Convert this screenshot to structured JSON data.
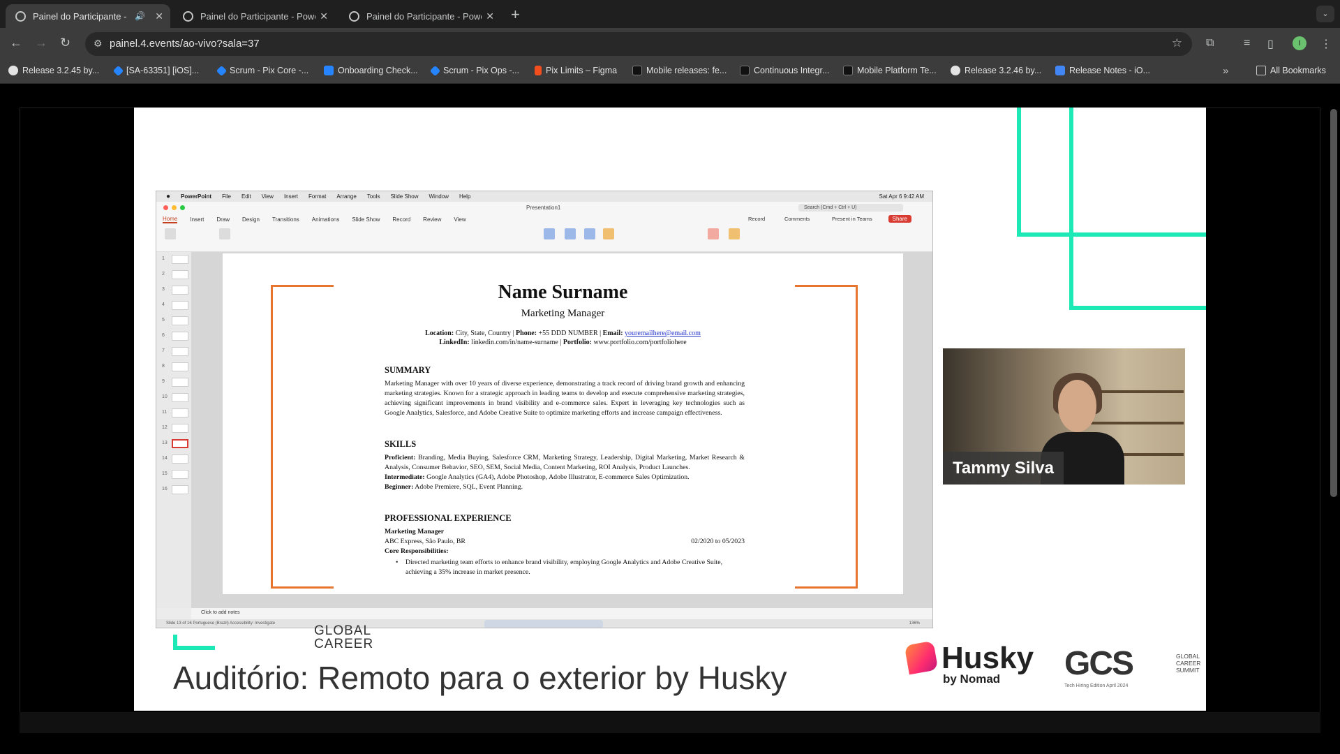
{
  "browser": {
    "tabs": [
      {
        "title": "Painel do Participante - P",
        "active": true
      },
      {
        "title": "Painel do Participante - Powe",
        "active": false
      },
      {
        "title": "Painel do Participante - Powe",
        "active": false
      }
    ],
    "url": "painel.4.events/ao-vivo?sala=37",
    "profile_initial": "I",
    "bookmarks": [
      {
        "label": "Release 3.2.45 by...",
        "color": "#e3e3e3"
      },
      {
        "label": "[SA-63351] [iOS]...",
        "color": "#2684ff"
      },
      {
        "label": "Scrum - Pix Core -...",
        "color": "#2684ff"
      },
      {
        "label": "Onboarding Check...",
        "color": "#2684ff"
      },
      {
        "label": "Scrum - Pix Ops -...",
        "color": "#2684ff"
      },
      {
        "label": "Pix Limits – Figma",
        "color": "#f24e1e"
      },
      {
        "label": "Mobile releases: fe...",
        "color": "#222222"
      },
      {
        "label": "Continuous Integr...",
        "color": "#222222"
      },
      {
        "label": "Mobile Platform Te...",
        "color": "#222222"
      },
      {
        "label": "Release 3.2.46 by...",
        "color": "#e3e3e3"
      },
      {
        "label": "Release Notes - iO...",
        "color": "#4285f4"
      }
    ],
    "all_bookmarks": "All Bookmarks"
  },
  "powerpoint": {
    "menu": [
      "PowerPoint",
      "File",
      "Edit",
      "View",
      "Insert",
      "Format",
      "Arrange",
      "Tools",
      "Slide Show",
      "Window",
      "Help"
    ],
    "clock": "Sat Apr 6  9:42 AM",
    "document_title": "Presentation1",
    "search_placeholder": "Search (Cmd + Ctrl + U)",
    "ribbon_tabs": [
      "Home",
      "Insert",
      "Draw",
      "Design",
      "Transitions",
      "Animations",
      "Slide Show",
      "Record",
      "Review",
      "View"
    ],
    "record": "Record",
    "comments": "Comments",
    "present_in_teams": "Present in Teams",
    "share": "Share",
    "notes_placeholder": "Click to add notes",
    "status": "Slide 13 of 16    Portuguese (Brazil)    Accessibility: Investigate",
    "zoom": "136%"
  },
  "resume": {
    "name": "Name Surname",
    "title": "Marketing Manager",
    "contact_line1_location_label": "Location:",
    "contact_line1_location": "City, State, Country |",
    "contact_line1_phone_label": "Phone:",
    "contact_line1_phone": "+55 DDD NUMBER |",
    "contact_line1_email_label": "Email:",
    "contact_line1_email": "youremailhere@email.com",
    "contact_line2_linkedin_label": "LinkedIn:",
    "contact_line2_linkedin": "linkedin.com/in/name-surname |",
    "contact_line2_portfolio_label": "Portfolio:",
    "contact_line2_portfolio": "www.portfolio.com/portfoliohere",
    "summary_heading": "SUMMARY",
    "summary_text": "Marketing Manager with over 10 years of diverse experience, demonstrating a track record of driving brand growth and enhancing marketing strategies. Known for a strategic approach in leading teams to develop and execute comprehensive marketing strategies, achieving significant improvements in brand visibility and e-commerce sales. Expert in leveraging key technologies such as Google Analytics, Salesforce, and Adobe Creative Suite to optimize marketing efforts and increase campaign effectiveness.",
    "skills_heading": "SKILLS",
    "skills_proficient_label": "Proficient:",
    "skills_proficient": "Branding, Media Buying, Salesforce CRM, Marketing Strategy, Leadership, Digital Marketing, Market Research & Analysis, Consumer Behavior, SEO, SEM, Social Media, Content Marketing, ROI Analysis, Product Launches.",
    "skills_intermediate_label": "Intermediate:",
    "skills_intermediate": "Google Analytics (GA4), Adobe Photoshop, Adobe Illustrator, E-commerce Sales Optimization.",
    "skills_beginner_label": "Beginner:",
    "skills_beginner": "Adobe Premiere, SQL, Event Planning.",
    "experience_heading": "PROFESSIONAL EXPERIENCE",
    "job_title": "Marketing Manager",
    "company": "ABC Express, São Paulo, BR",
    "dates": "02/2020 to 05/2023",
    "core_label": "Core Responsibilities:",
    "bullet1": "Directed marketing team efforts to enhance brand visibility, employing Google Analytics and Adobe Creative Suite, achieving a 35% increase in market presence."
  },
  "webcam": {
    "speaker_name": "Tammy Silva"
  },
  "banner": {
    "auditorium": "Auditório: Remoto para o exterior by Husky",
    "peek_text": "GLOBAL\nCAREER",
    "husky": "Husky",
    "husky_by": "by Nomad",
    "gcs": "GCS",
    "gcs_sub": "GLOBAL CAREER SUMMIT",
    "gcs_edition": "Tech Hiring Edition    April 2024"
  },
  "colors": {
    "accent_teal": "#1de9b6",
    "bracket_orange": "#e8752f",
    "share_red": "#d83b32"
  }
}
